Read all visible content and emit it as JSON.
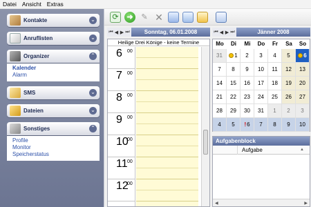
{
  "menu": [
    "Datei",
    "Ansicht",
    "Extras"
  ],
  "sidebar": {
    "groups": [
      {
        "label": "Kontakte",
        "icon": "contacts-icon",
        "expanded": false,
        "items": []
      },
      {
        "label": "Anruflisten",
        "icon": "call-list-icon",
        "expanded": false,
        "items": []
      },
      {
        "label": "Organizer",
        "icon": "organizer-icon",
        "expanded": true,
        "items": [
          {
            "label": "Kalender",
            "bold": true
          },
          {
            "label": "Alarm",
            "bold": false
          }
        ]
      },
      {
        "label": "SMS",
        "icon": "sms-icon",
        "expanded": false,
        "items": []
      },
      {
        "label": "Dateien",
        "icon": "folder-icon",
        "expanded": false,
        "items": []
      },
      {
        "label": "Sonstiges",
        "icon": "misc-icon",
        "expanded": true,
        "items": [
          {
            "label": "Profile",
            "bold": false
          },
          {
            "label": "Monitor",
            "bold": false
          },
          {
            "label": "Speicherstatus",
            "bold": false
          }
        ]
      }
    ]
  },
  "toolbar": {
    "buttons": [
      "refresh-icon",
      "go-icon",
      "edit-icon",
      "delete-icon",
      "new-appointment-icon",
      "new-event-icon",
      "new-reminder-icon",
      "list-view-icon"
    ]
  },
  "day": {
    "nav": [
      "⏮",
      "◀",
      "▶",
      "⏭"
    ],
    "title": "Sonntag, 06.01.2008",
    "holiday": "Heilige Drei Könige - keine Termine",
    "hours": [
      "6",
      "7",
      "8",
      "9",
      "10",
      "11",
      "12"
    ],
    "minutes": "00"
  },
  "month": {
    "nav": [
      "⏮",
      "◀",
      "▶",
      "⏭"
    ],
    "title": "Jänner 2008",
    "weekdays": [
      "Mo",
      "Di",
      "Mi",
      "Do",
      "Fr",
      "Sa",
      "So"
    ],
    "rows": [
      [
        {
          "d": "31",
          "t": "other"
        },
        {
          "d": "1",
          "t": "",
          "mark": "dot"
        },
        {
          "d": "2",
          "t": ""
        },
        {
          "d": "3",
          "t": ""
        },
        {
          "d": "4",
          "t": ""
        },
        {
          "d": "5",
          "t": "wk"
        },
        {
          "d": "6",
          "t": "sel",
          "mark": "dot"
        }
      ],
      [
        {
          "d": "7",
          "t": ""
        },
        {
          "d": "8",
          "t": ""
        },
        {
          "d": "9",
          "t": ""
        },
        {
          "d": "10",
          "t": ""
        },
        {
          "d": "11",
          "t": ""
        },
        {
          "d": "12",
          "t": "wk"
        },
        {
          "d": "13",
          "t": "wk"
        }
      ],
      [
        {
          "d": "14",
          "t": ""
        },
        {
          "d": "15",
          "t": ""
        },
        {
          "d": "16",
          "t": ""
        },
        {
          "d": "17",
          "t": ""
        },
        {
          "d": "18",
          "t": ""
        },
        {
          "d": "19",
          "t": "wk"
        },
        {
          "d": "20",
          "t": "wk"
        }
      ],
      [
        {
          "d": "21",
          "t": ""
        },
        {
          "d": "22",
          "t": ""
        },
        {
          "d": "23",
          "t": ""
        },
        {
          "d": "24",
          "t": ""
        },
        {
          "d": "25",
          "t": ""
        },
        {
          "d": "26",
          "t": "wk"
        },
        {
          "d": "27",
          "t": "wk"
        }
      ],
      [
        {
          "d": "28",
          "t": ""
        },
        {
          "d": "29",
          "t": ""
        },
        {
          "d": "30",
          "t": ""
        },
        {
          "d": "31",
          "t": ""
        },
        {
          "d": "1",
          "t": "other"
        },
        {
          "d": "2",
          "t": "other"
        },
        {
          "d": "3",
          "t": "other"
        }
      ],
      [
        {
          "d": "4",
          "t": "next"
        },
        {
          "d": "5",
          "t": "next"
        },
        {
          "d": "6",
          "t": "next",
          "mark": "bang"
        },
        {
          "d": "7",
          "t": "next"
        },
        {
          "d": "8",
          "t": "next"
        },
        {
          "d": "9",
          "t": "next"
        },
        {
          "d": "10",
          "t": "next"
        }
      ]
    ]
  },
  "tasks": {
    "title": "Aufgabenblock",
    "column": "Aufgabe"
  }
}
